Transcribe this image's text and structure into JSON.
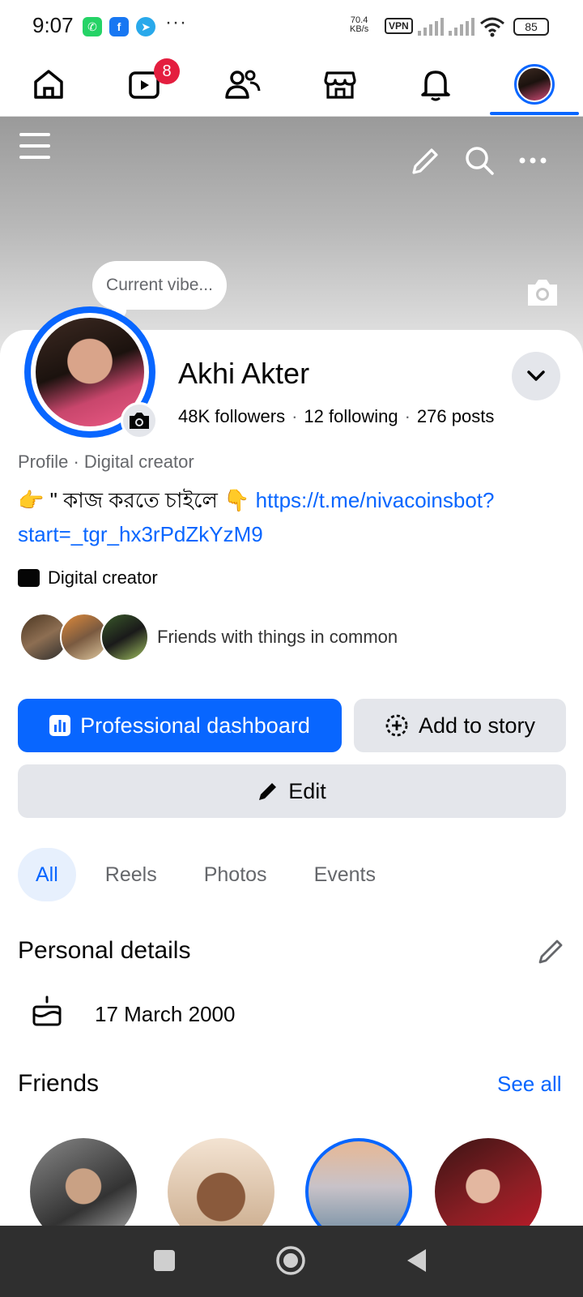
{
  "status_bar": {
    "time": "9:07",
    "more": "···",
    "speed_top": "70.4",
    "speed_bottom": "KB/s",
    "vpn": "VPN",
    "battery": "85",
    "apps": [
      "whatsapp-icon",
      "facebook-icon",
      "telegram-icon"
    ]
  },
  "top_nav": {
    "items": [
      "home-icon",
      "video-icon",
      "friends-icon",
      "marketplace-icon",
      "notifications-icon",
      "profile-avatar"
    ],
    "video_badge": "8",
    "active_index": 5
  },
  "cover": {
    "vibe_prompt": "Current vibe..."
  },
  "profile": {
    "name": "Akhi Akter",
    "followers": "48K followers",
    "following": "12 following",
    "posts": "276 posts",
    "profile_label": "Profile",
    "profile_category": "Digital creator",
    "bio_text": "👉 \" কাজ করতে চাইলে 👇 ",
    "bio_link": "https://t.me/nivacoinsbot?start=_tgr_hx3rPdZkYzM9",
    "category": "Digital creator",
    "mutual_text": "Friends with things in common"
  },
  "actions": {
    "dashboard": "Professional dashboard",
    "add_story": "Add to story",
    "edit": "Edit"
  },
  "tabs": [
    {
      "label": "All",
      "active": true
    },
    {
      "label": "Reels",
      "active": false
    },
    {
      "label": "Photos",
      "active": false
    },
    {
      "label": "Events",
      "active": false
    }
  ],
  "personal_details": {
    "title": "Personal details",
    "birthday": "17 March 2000"
  },
  "friends": {
    "title": "Friends",
    "see_all": "See all"
  },
  "colors": {
    "accent": "#0866ff",
    "badge": "#e41e3f",
    "button_gray": "#e4e6eb"
  }
}
